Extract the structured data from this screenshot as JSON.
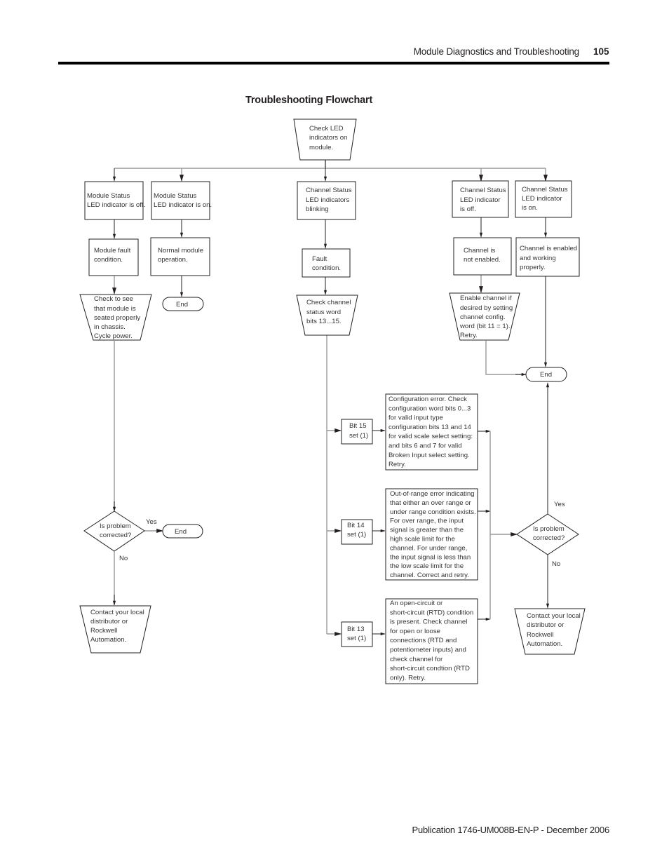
{
  "header": {
    "section": "Module Diagnostics and Troubleshooting",
    "page_number": "105"
  },
  "title": "Troubleshooting Flowchart",
  "footer": "Publication 1746-UM008B-EN-P - December 2006",
  "flowchart": {
    "start": [
      "Check LED",
      "indicators on",
      "module."
    ],
    "module_off": [
      "Module Status",
      "LED indicator is off."
    ],
    "module_on": [
      "Module Status",
      "LED indicator is on."
    ],
    "channel_blinking": [
      "Channel Status",
      "LED indicators",
      "blinking"
    ],
    "channel_off": [
      "Channel Status",
      "LED indicator",
      "is off."
    ],
    "channel_on": [
      "Channel Status",
      "LED indicator",
      "is on."
    ],
    "module_fault": [
      "Module fault",
      "condition."
    ],
    "normal_operation": [
      "Normal module",
      "operation."
    ],
    "fault_condition": [
      "Fault",
      "condition."
    ],
    "channel_not_enabled": [
      "Channel is",
      "not enabled."
    ],
    "channel_enabled": [
      "Channel is enabled",
      "and working",
      "properly."
    ],
    "check_seated": [
      "Check to see",
      "that module is",
      "seated properly",
      "in chassis.",
      "Cycle power."
    ],
    "check_status_word": [
      "Check channel",
      "status word",
      "bits 13...15."
    ],
    "enable_channel": [
      "Enable channel if",
      "desired by setting",
      "channel config.",
      "word (bit 11 = 1).",
      "Retry."
    ],
    "end_label": "End",
    "bit15": [
      "Bit 15",
      "set (1)"
    ],
    "bit14": [
      "Bit 14",
      "set (1)"
    ],
    "bit13": [
      "Bit 13",
      "set (1)"
    ],
    "config_error": [
      "Configuration error. Check",
      "configuration word bits 0...3",
      "for valid input type",
      "configuration bits 13 and 14",
      "for valid scale select setting:",
      "and bits 6 and 7 for valid",
      "Broken Input select setting.",
      "Retry."
    ],
    "out_of_range": [
      "Out-of-range error indicating",
      "that either an over range or",
      "under range condition exists.",
      "For over range, the input",
      "signal is greater than the",
      "high scale limit for the",
      "channel. For under range,",
      "the input signal is less than",
      "the low scale limit for the",
      "channel. Correct and retry."
    ],
    "open_circuit": [
      "An open-circuit or",
      "short-circuit (RTD) condition",
      "is present. Check channel",
      "for open or loose",
      "connections (RTD and",
      "potentiometer inputs) and",
      "check channel for",
      "short-circuit condtion (RTD",
      "only). Retry."
    ],
    "decision": [
      "Is problem",
      "corrected?"
    ],
    "yes": "Yes",
    "no": "No",
    "contact": [
      "Contact your local",
      "distributor or",
      "Rockwell",
      "Automation."
    ]
  }
}
